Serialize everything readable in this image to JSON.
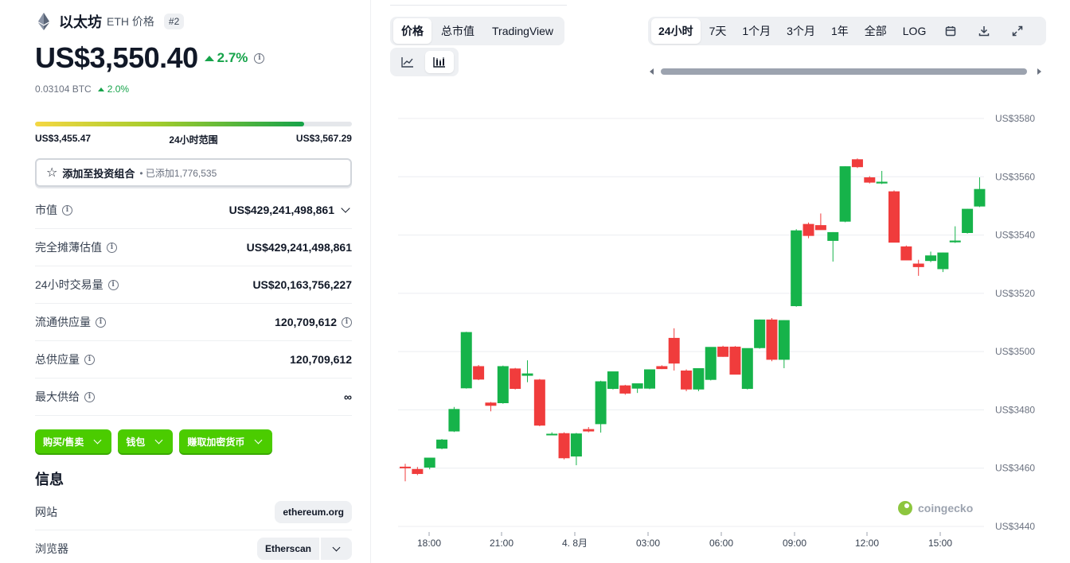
{
  "coin": {
    "name": "以太坊",
    "symbol_label": "ETH 价格",
    "rank": "#2",
    "price": "US$3,550.40",
    "change_pct": "2.7%",
    "btc_price": "0.03104 BTC",
    "btc_change": "2.0%"
  },
  "range": {
    "low": "US$3,455.47",
    "label": "24小时范围",
    "high": "US$3,567.29",
    "fill_fraction": 0.85
  },
  "portfolio": {
    "label": "添加至投资组合",
    "added": "• 已添加1,776,535"
  },
  "stats": [
    {
      "label": "市值",
      "value": "US$429,241,498,861"
    },
    {
      "label": "完全摊薄估值",
      "value": "US$429,241,498,861"
    },
    {
      "label": "24小时交易量",
      "value": "US$20,163,756,227"
    },
    {
      "label": "流通供应量",
      "value": "120,709,612"
    },
    {
      "label": "总供应量",
      "value": "120,709,612"
    },
    {
      "label": "最大供给",
      "value": "∞"
    }
  ],
  "actions": [
    "购买/售卖",
    "钱包",
    "赚取加密货币"
  ],
  "info": {
    "title": "信息",
    "website_label": "网站",
    "website_value": "ethereum.org",
    "explorer_label": "浏览器",
    "explorer_value": "Etherscan"
  },
  "chart_tabs": [
    "价格",
    "总市值",
    "TradingView"
  ],
  "periods": [
    "24小时",
    "7天",
    "1个月",
    "3个月",
    "1年",
    "全部",
    "LOG"
  ],
  "icons": {
    "line_chart": "line-chart-icon",
    "candle_chart": "candlestick-icon",
    "calendar": "calendar-icon",
    "download": "download-icon",
    "fullscreen": "expand-icon"
  },
  "colors": {
    "up": "#16a34a",
    "candle_up": "#16b34a",
    "candle_down": "#f03c3c",
    "action_green": "#4bcc00"
  },
  "watermark": "coingecko",
  "chart_data": {
    "type": "candlestick",
    "x_ticks": [
      "18:00",
      "21:00",
      "4. 8月",
      "03:00",
      "06:00",
      "09:00",
      "12:00",
      "15:00"
    ],
    "y_ticks": [
      "US$3580",
      "US$3560",
      "US$3540",
      "US$3520",
      "US$3500",
      "US$3480",
      "US$3460",
      "US$3440"
    ],
    "ylim": [
      3440,
      3580
    ],
    "candles": [
      [
        3460.5,
        3461.5,
        3455.5,
        3460.0
      ],
      [
        3459.7,
        3460.4,
        3457.6,
        3458.0
      ],
      [
        3460.2,
        3463.5,
        3459.6,
        3463.6
      ],
      [
        3466.7,
        3470.0,
        3466.5,
        3469.8
      ],
      [
        3472.6,
        3481.0,
        3472.4,
        3480.3
      ],
      [
        3487.4,
        3506.8,
        3487.3,
        3506.7
      ],
      [
        3495.0,
        3495.4,
        3490.2,
        3490.4
      ],
      [
        3482.5,
        3482.7,
        3479.5,
        3481.4
      ],
      [
        3482.3,
        3495.2,
        3482.1,
        3495.0
      ],
      [
        3494.2,
        3494.4,
        3487.0,
        3487.2
      ],
      [
        3491.7,
        3497.0,
        3489.5,
        3492.5
      ],
      [
        3490.4,
        3490.6,
        3474.4,
        3474.6
      ],
      [
        3471.8,
        3472.3,
        3471.5,
        3471.8
      ],
      [
        3472.0,
        3472.3,
        3463.0,
        3463.4
      ],
      [
        3464.0,
        3472.1,
        3461.0,
        3471.9
      ],
      [
        3473.4,
        3474.1,
        3472.3,
        3472.6
      ],
      [
        3475.1,
        3490.0,
        3472.2,
        3489.8
      ],
      [
        3487.2,
        3493.0,
        3487.0,
        3493.2
      ],
      [
        3488.4,
        3488.6,
        3485.2,
        3485.6
      ],
      [
        3487.3,
        3488.7,
        3485.8,
        3489.1
      ],
      [
        3487.3,
        3493.7,
        3487.1,
        3493.9
      ],
      [
        3495.0,
        3495.3,
        3494.0,
        3494.0
      ],
      [
        3504.7,
        3508.0,
        3493.5,
        3495.9
      ],
      [
        3493.5,
        3493.9,
        3486.4,
        3487.0
      ],
      [
        3487.0,
        3494.0,
        3486.4,
        3494.3
      ],
      [
        3490.3,
        3501.5,
        3490.1,
        3501.6
      ],
      [
        3501.7,
        3502.0,
        3498.2,
        3498.2
      ],
      [
        3501.7,
        3501.9,
        3492.9,
        3492.1
      ],
      [
        3487.2,
        3501.0,
        3487.0,
        3501.2
      ],
      [
        3501.2,
        3511.0,
        3501.0,
        3511.0
      ],
      [
        3511.0,
        3511.5,
        3496.7,
        3497.2
      ],
      [
        3497.2,
        3510.8,
        3494.3,
        3510.8
      ],
      [
        3515.6,
        3542.0,
        3515.4,
        3541.6
      ],
      [
        3543.8,
        3544.3,
        3538.9,
        3539.7
      ],
      [
        3543.4,
        3547.4,
        3541.9,
        3541.7
      ],
      [
        3538.0,
        3541.0,
        3530.9,
        3541.0
      ],
      [
        3544.6,
        3563.6,
        3544.4,
        3563.6
      ],
      [
        3566.0,
        3566.3,
        3563.0,
        3563.3
      ],
      [
        3559.8,
        3560.2,
        3557.7,
        3558.0
      ],
      [
        3557.7,
        3562.0,
        3557.5,
        3558.3
      ],
      [
        3555.0,
        3555.3,
        3538.0,
        3537.4
      ],
      [
        3536.1,
        3536.4,
        3531.4,
        3531.3
      ],
      [
        3530.2,
        3531.5,
        3526.0,
        3529.0
      ],
      [
        3531.1,
        3534.3,
        3530.7,
        3533.0
      ],
      [
        3528.3,
        3534.0,
        3527.3,
        3534.0
      ],
      [
        3537.5,
        3543.0,
        3537.3,
        3538.1
      ],
      [
        3540.7,
        3549.0,
        3540.5,
        3549.0
      ],
      [
        3549.8,
        3559.8,
        3549.6,
        3555.8
      ]
    ]
  }
}
